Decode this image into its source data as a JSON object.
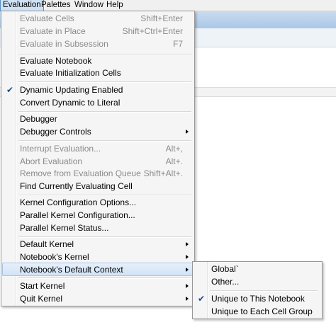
{
  "menubar": {
    "items": [
      "Evaluation",
      "Palettes",
      "Window",
      "Help"
    ]
  },
  "menu": {
    "items": [
      {
        "label": "Evaluate Cells",
        "shortcut": "Shift+Enter"
      },
      {
        "label": "Evaluate in Place",
        "shortcut": "Shift+Ctrl+Enter"
      },
      {
        "label": "Evaluate in Subsession",
        "shortcut": "F7"
      },
      {
        "label": "Evaluate Notebook"
      },
      {
        "label": "Evaluate Initialization Cells"
      },
      {
        "label": "Dynamic Updating Enabled",
        "check": "✔"
      },
      {
        "label": "Convert Dynamic to Literal"
      },
      {
        "label": "Debugger"
      },
      {
        "label": "Debugger Controls"
      },
      {
        "label": "Interrupt Evaluation...",
        "shortcut": "Alt+,"
      },
      {
        "label": "Abort Evaluation",
        "shortcut": "Alt+."
      },
      {
        "label": "Remove from Evaluation Queue",
        "shortcut": "Shift+Alt+."
      },
      {
        "label": "Find Currently Evaluating Cell"
      },
      {
        "label": "Kernel Configuration Options..."
      },
      {
        "label": "Parallel Kernel Configuration..."
      },
      {
        "label": "Parallel Kernel Status..."
      },
      {
        "label": "Default Kernel"
      },
      {
        "label": "Notebook's Kernel"
      },
      {
        "label": "Notebook's Default Context"
      },
      {
        "label": "Start Kernel"
      },
      {
        "label": "Quit Kernel"
      }
    ]
  },
  "submenu": {
    "items": [
      {
        "label": "Global`"
      },
      {
        "label": "Other..."
      },
      {
        "label": "Unique to This Notebook",
        "check": "✔"
      },
      {
        "label": "Unique to Each Cell Group"
      }
    ]
  }
}
